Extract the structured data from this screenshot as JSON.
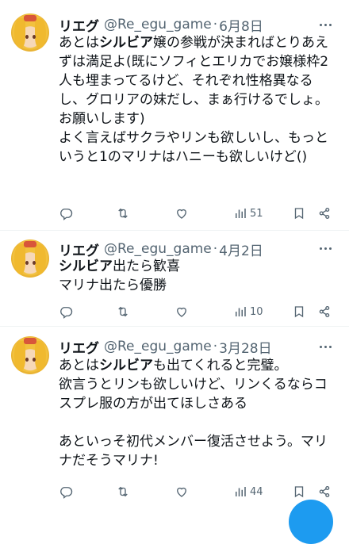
{
  "tweets": [
    {
      "name": "リエグ",
      "handle": "@Re_egu_game",
      "date": "6月8日",
      "text_before": "あとは",
      "text_bold": "シルビア",
      "text_after": "嬢の参戦が決まればとりあえずは満足よ(既にソフィとエリカでお嬢様枠2人も埋まってるけど、それぞれ性格異なるし、グロリアの妹だし、まぁ行けるでしょ。お願いします)\nよく言えばサクラやリンも欲しいし、もっというと1のマリナはハニーも欲しいけど()",
      "views": "51"
    },
    {
      "name": "リエグ",
      "handle": "@Re_egu_game",
      "date": "4月2日",
      "text_before": "",
      "text_bold": "シルビア",
      "text_after": "出たら歓喜\nマリナ出たら優勝",
      "views": "10"
    },
    {
      "name": "リエグ",
      "handle": "@Re_egu_game",
      "date": "3月28日",
      "text_before": "あとは",
      "text_bold": "シルビア",
      "text_after": "も出てくれると完璧。\n欲言うとリンも欲しいけど、リンくるならコスプレ服の方が出てほしさある\n\nあといっそ初代メンバー復活させよう。マリナだそうマリナ!",
      "views": "44"
    }
  ],
  "separator": "·",
  "colors": {
    "text": "#0f1419",
    "muted": "#536471",
    "divider": "#eff3f4",
    "accent": "#1d9bf0"
  },
  "icons": [
    "reply-icon",
    "retweet-icon",
    "like-icon",
    "views-icon",
    "bookmark-icon",
    "share-icon"
  ]
}
